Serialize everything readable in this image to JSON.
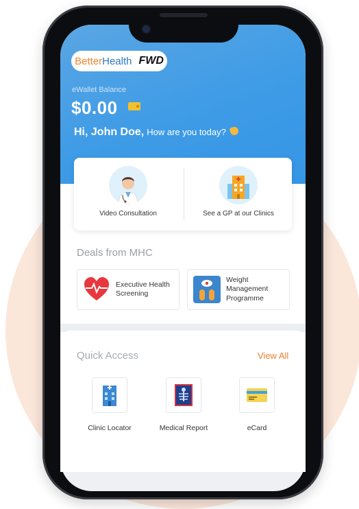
{
  "brand": {
    "better": "Better",
    "health": "Health",
    "fwd": "FWD"
  },
  "wallet": {
    "label": "eWallet Balance",
    "amount": "$0.00"
  },
  "greeting": {
    "name": "Hi, John Doe,",
    "sub": "How are you today?"
  },
  "services": [
    {
      "label": "Video Consultation",
      "icon": "doctor-icon"
    },
    {
      "label": "See a GP at our Clinics",
      "icon": "clinic-building-icon"
    }
  ],
  "deals": {
    "title": "Deals from MHC",
    "items": [
      {
        "label_lines": [
          "Executive Health",
          "Screening"
        ],
        "icon": "heartbeat-icon"
      },
      {
        "label_lines": [
          "Weight",
          "Management",
          "Programme"
        ],
        "icon": "weight-scale-icon"
      }
    ]
  },
  "quick_access": {
    "title": "Quick Access",
    "view_all": "View All",
    "items": [
      {
        "label": "Clinic Locator",
        "icon": "clinic-locator-icon"
      },
      {
        "label": "Medical Report",
        "icon": "xray-report-icon"
      },
      {
        "label": "eCard",
        "icon": "ecard-icon"
      }
    ]
  },
  "colors": {
    "header_blue": "#3d9be6",
    "accent_orange": "#ef7d2c",
    "background_peach": "#fbe7da"
  }
}
